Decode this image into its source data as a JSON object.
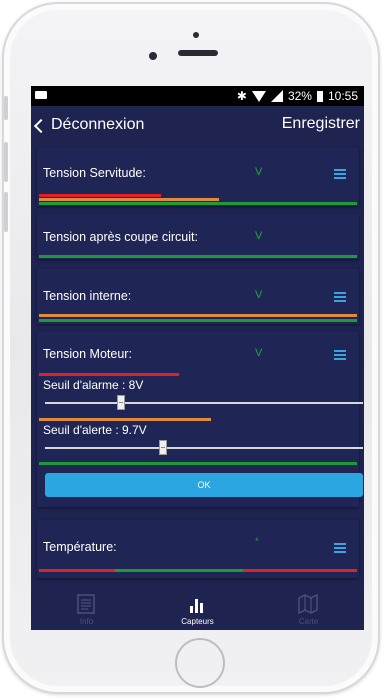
{
  "status_bar": {
    "bluetooth": "✱",
    "battery_percent": "32%",
    "time": "10:55"
  },
  "nav": {
    "back_label": "Déconnexion",
    "save_label": "Enregistrer"
  },
  "cards": {
    "servitude": {
      "title": "Tension Servitude:",
      "value": "V"
    },
    "coupe_circuit": {
      "title": "Tension après coupe circuit:",
      "value": "V"
    },
    "interne": {
      "title": "Tension interne:",
      "value": "V"
    },
    "moteur": {
      "title": "Tension Moteur:",
      "value": "V",
      "alarm_label": "Seuil d'alarme : 8V",
      "alarm_level": 0.24,
      "alert_label": "Seuil d'alerte : 9.7V",
      "alert_level": 0.37,
      "ok_label": "OK"
    },
    "temperature": {
      "title": "Température:",
      "value": "*"
    }
  },
  "tabs": [
    {
      "label": "Info",
      "icon": "info-document-icon",
      "active": false
    },
    {
      "label": "Capteurs",
      "icon": "bar-chart-icon",
      "active": true
    },
    {
      "label": "Carte",
      "icon": "map-icon",
      "active": false
    }
  ],
  "colors": {
    "background": "#1e2350",
    "accent": "#2ba6e0",
    "green": "#1f9a3a",
    "orange": "#e08a3c",
    "red": "#e0202a"
  }
}
